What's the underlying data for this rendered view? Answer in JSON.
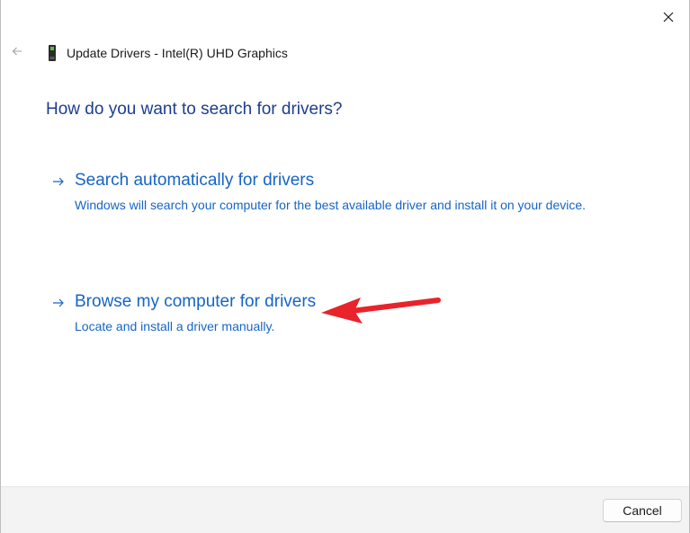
{
  "window": {
    "title": "Update Drivers - Intel(R) UHD Graphics"
  },
  "icons": {
    "close": "close-icon",
    "back": "back-arrow-icon",
    "device": "display-adapter-icon",
    "option_arrow": "right-arrow-icon"
  },
  "main": {
    "question": "How do you want to search for drivers?",
    "options": [
      {
        "title": "Search automatically for drivers",
        "description": "Windows will search your computer for the best available driver and install it on your device."
      },
      {
        "title": "Browse my computer for drivers",
        "description": "Locate and install a driver manually."
      }
    ]
  },
  "footer": {
    "cancel_label": "Cancel"
  },
  "colors": {
    "heading": "#1d3d8f",
    "link": "#1664c6",
    "annotation": "#e8232b",
    "footer_bg": "#f3f3f3"
  }
}
